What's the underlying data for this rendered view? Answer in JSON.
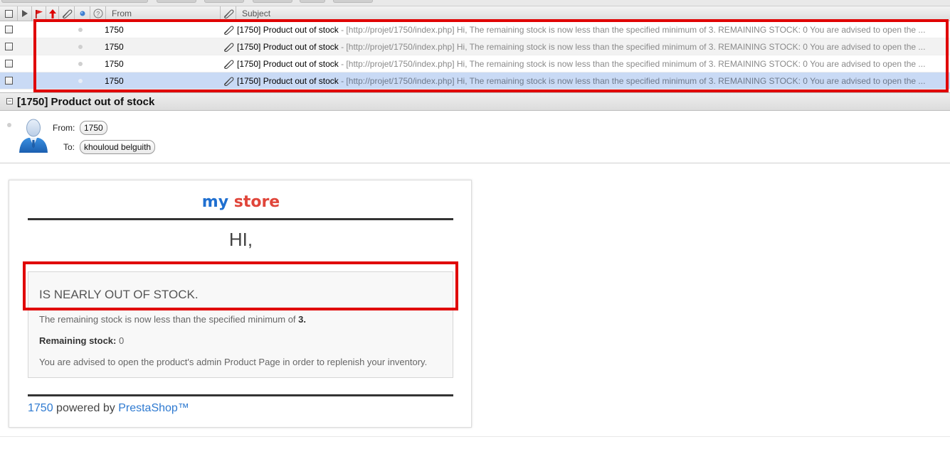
{
  "columns": {
    "from": "From",
    "subject": "Subject"
  },
  "messages": [
    {
      "from": "1750",
      "subject": "[1750] Product out of stock",
      "preview": " - [http://projet/1750/index.php] Hi, The remaining stock is now less than the specified minimum of 3. REMAINING STOCK: 0 You are advised to open the ..."
    },
    {
      "from": "1750",
      "subject": "[1750] Product out of stock",
      "preview": " - [http://projet/1750/index.php] Hi, The remaining stock is now less than the specified minimum of 3. REMAINING STOCK: 0 You are advised to open the ..."
    },
    {
      "from": "1750",
      "subject": "[1750] Product out of stock",
      "preview": " - [http://projet/1750/index.php] Hi, The remaining stock is now less than the specified minimum of 3. REMAINING STOCK: 0 You are advised to open the ..."
    },
    {
      "from": "1750",
      "subject": "[1750] Product out of stock",
      "preview": " - [http://projet/1750/index.php] Hi, The remaining stock is now less than the specified minimum of 3. REMAINING STOCK: 0 You are advised to open the ..."
    }
  ],
  "preview": {
    "title": "[1750] Product out of stock",
    "from_label": "From:",
    "from_value": "1750",
    "to_label": "To:",
    "to_value": "khouloud belguith"
  },
  "email": {
    "logo_my": "my",
    "logo_store": "store",
    "greeting": "HI,",
    "headline": "IS NEARLY OUT OF STOCK.",
    "line1_text": "The remaining stock is now less than the specified minimum of ",
    "line1_value": "3.",
    "line2_label": "Remaining stock:",
    "line2_value": " 0",
    "line3_text": "You are advised to open the product's admin Product Page in order to replenish your inventory.",
    "footer_shop": "1750",
    "footer_mid": " powered by ",
    "footer_link": "PrestaShop™"
  },
  "colors": {
    "highlight": "#e00000",
    "selected_row": "#c9daf5",
    "link": "#2e7ad1"
  }
}
